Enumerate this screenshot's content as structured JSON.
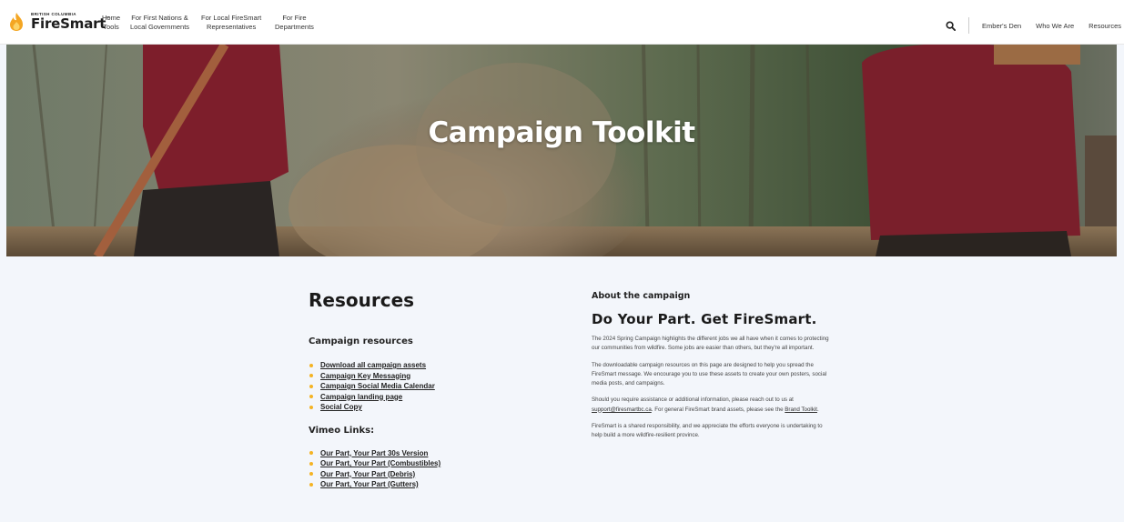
{
  "header": {
    "logo_small": "BRITISH COLUMBIA",
    "logo_big": "FireSmart",
    "logo_tm": "™",
    "nav": [
      "Home\nTools",
      "For First Nations &\nLocal Governments",
      "For Local FireSmart\nRepresentatives",
      "For Fire\nDepartments"
    ],
    "right_nav": [
      "Ember's Den",
      "Who We Are",
      "Resources"
    ],
    "search_icon": "search-icon"
  },
  "hero": {
    "title": "Campaign Toolkit"
  },
  "resources": {
    "title": "Resources",
    "campaign_heading": "Campaign resources",
    "campaign_links": [
      "Download all campaign assets",
      "Campaign Key Messaging",
      "Campaign Social Media Calendar",
      "Campaign landing page",
      "Social Copy"
    ],
    "vimeo_heading": "Vimeo Links:",
    "vimeo_links": [
      "Our Part, Your Part 30s Version",
      "Our Part, Your Part (Combustibles)",
      "Our Part, Your Part (Debris)",
      "Our Part, Your Part (Gutters)"
    ]
  },
  "about": {
    "heading": "About the campaign",
    "tagline": "Do Your Part. Get FireSmart.",
    "p1": "The 2024 Spring Campaign highlights the different jobs we all have when it comes to protecting our communities from wildfire. Some jobs are easier than others, but they're all important.",
    "p2": "The downloadable campaign resources on this page are designed to help you spread the FireSmart message. We encourage you to use these assets to create your own posters, social media posts, and campaigns.",
    "p3_pre": "Should you require assistance or additional information, please reach out to us at ",
    "p3_email": "support@firesmartbc.ca",
    "p3_mid": ". For general FireSmart brand assets, please see the ",
    "p3_link": "Brand Toolkit",
    "p3_post": ".",
    "p4": "FireSmart is a shared responsibility, and we appreciate the efforts everyone is undertaking to help build a more wildfire-resilient province."
  },
  "colors": {
    "accent": "#f4b323",
    "page_bg": "#f3f6fb",
    "hero_shirt": "#7a1f2b"
  }
}
